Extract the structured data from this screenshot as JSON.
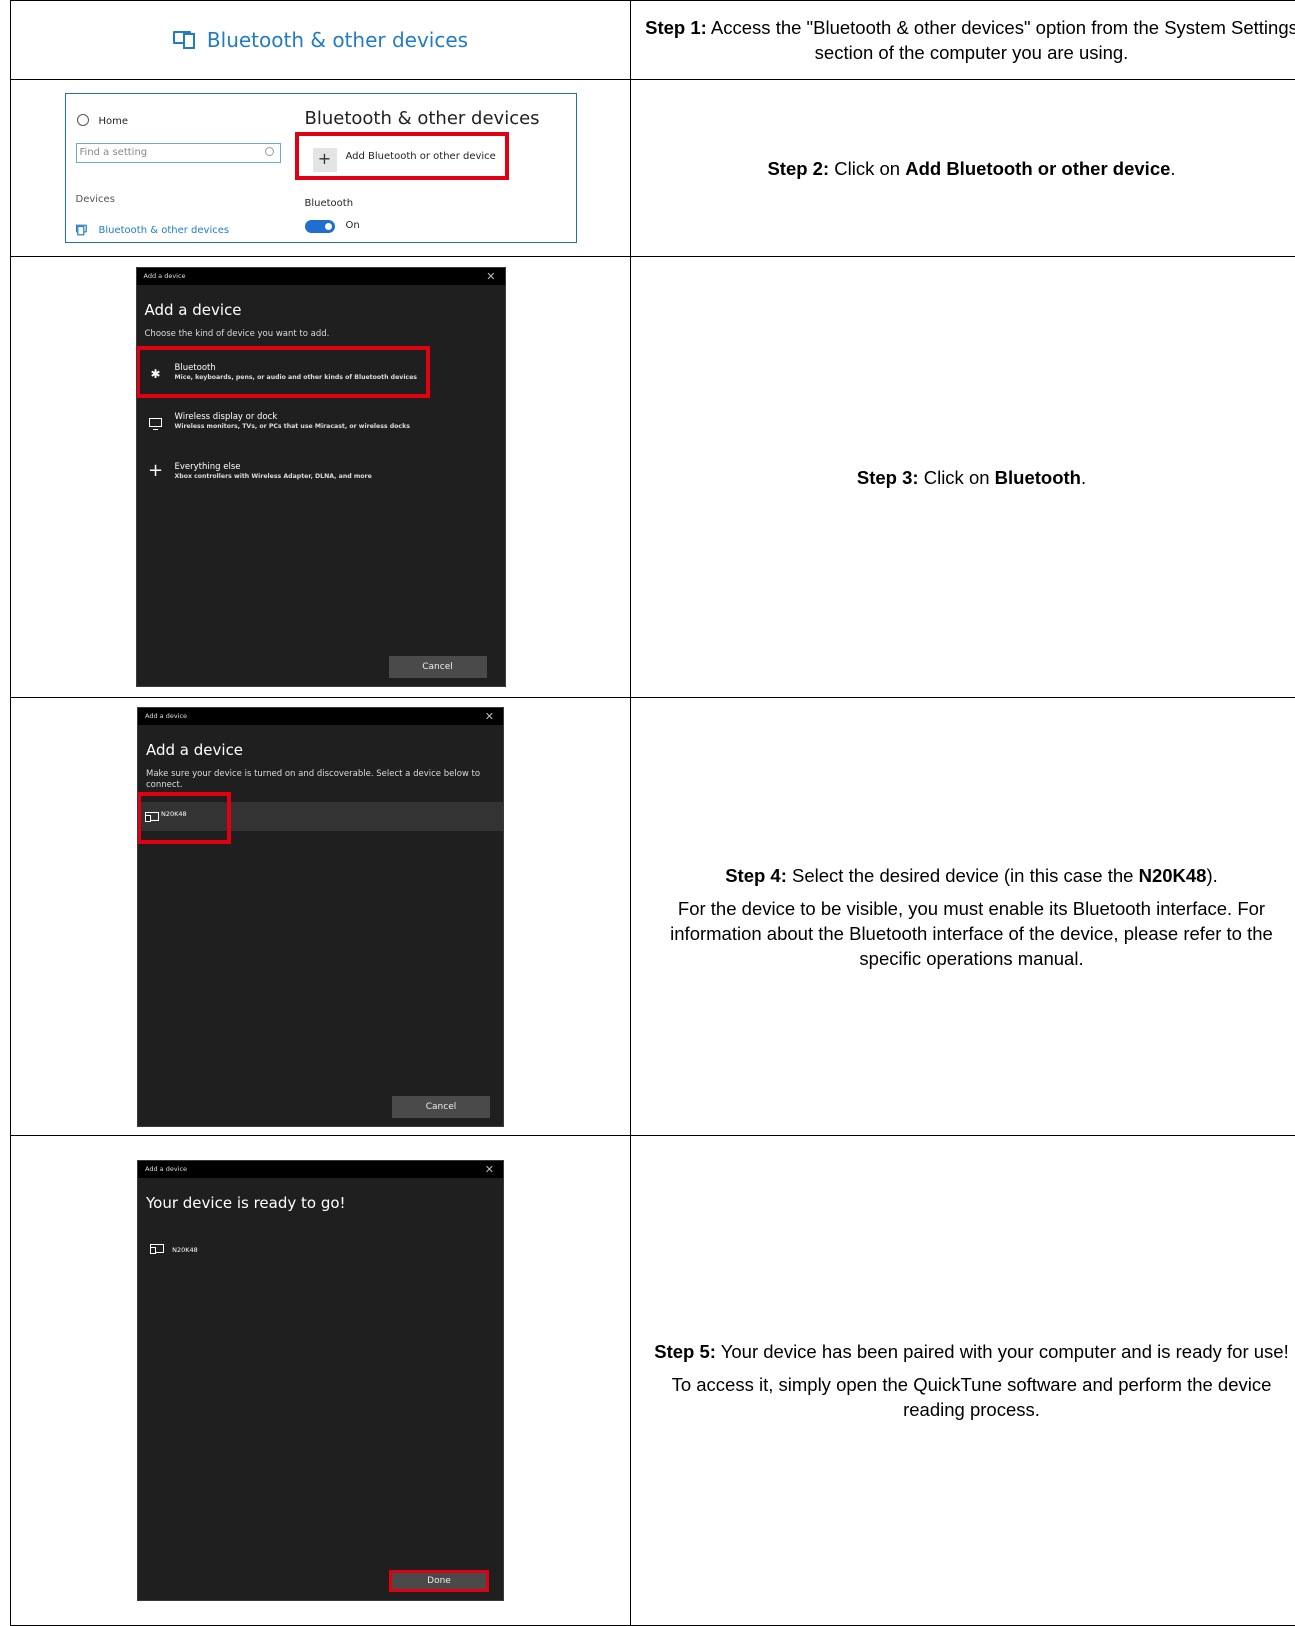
{
  "step1": {
    "banner_title": "Bluetooth & other devices",
    "num": "Step 1:",
    "text": " Access the \"Bluetooth & other devices\" option from the System Settings section of the computer you are using."
  },
  "step2": {
    "settings": {
      "home": "Home",
      "search_placeholder": "Find a setting",
      "section": "Devices",
      "nav_item": "Bluetooth & other devices",
      "page_title": "Bluetooth & other devices",
      "add_button": "Add Bluetooth or other device",
      "bluetooth_label": "Bluetooth",
      "toggle_state": "On"
    },
    "num": "Step 2:",
    "text_pre": " Click on ",
    "text_bold": "Add Bluetooth or other device",
    "text_post": "."
  },
  "step3": {
    "dialog": {
      "window_title": "Add a device",
      "heading": "Add a device",
      "subtitle": "Choose the kind of device you want to add.",
      "options": [
        {
          "title": "Bluetooth",
          "desc": "Mice, keyboards, pens, or audio and other kinds of Bluetooth devices",
          "icon": "bluetooth-icon"
        },
        {
          "title": "Wireless display or dock",
          "desc": "Wireless monitors, TVs, or PCs that use Miracast, or wireless docks",
          "icon": "monitor-icon"
        },
        {
          "title": "Everything else",
          "desc": "Xbox controllers with Wireless Adapter, DLNA, and more",
          "icon": "plus-icon"
        }
      ],
      "cancel": "Cancel"
    },
    "num": "Step 3:",
    "text_pre": " Click on ",
    "text_bold": "Bluetooth",
    "text_post": "."
  },
  "step4": {
    "dialog": {
      "window_title": "Add a device",
      "heading": "Add a device",
      "subtitle": "Make sure your device is turned on and discoverable. Select a device below to connect.",
      "device": "N20K48",
      "cancel": "Cancel"
    },
    "num": "Step 4:",
    "text_pre": " Select the desired device (in this case the ",
    "text_bold": "N20K48",
    "text_post": ").",
    "note": "For the device to be visible, you must enable its Bluetooth interface. For information about the Bluetooth interface of the device, please refer to the specific operations manual."
  },
  "step5": {
    "dialog": {
      "window_title": "Add a device",
      "heading": "Your device is ready to go!",
      "device": "N20K48",
      "done": "Done"
    },
    "num": "Step 5:",
    "text": " Your device has been paired with your computer and is ready for use!",
    "note": "To access it, simply open the QuickTune software and perform the device reading process."
  },
  "colors": {
    "accent": "#1f7dc5",
    "highlight": "#e00012",
    "dialog_bg": "#1f1f1f"
  }
}
